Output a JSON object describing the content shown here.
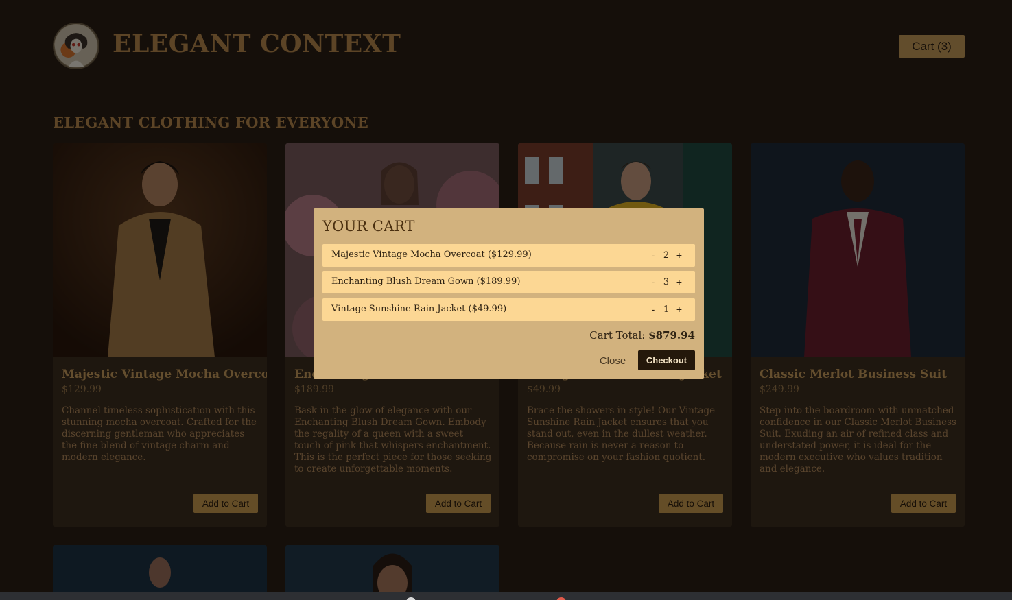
{
  "header": {
    "brand": "ELEGANT CONTEXT",
    "cart_label": "Cart (3)"
  },
  "section_title": "ELEGANT CLOTHING FOR EVERYONE",
  "products": [
    {
      "title": "Majestic Vintage Mocha Overcoat",
      "price": "$129.99",
      "desc": "Channel timeless sophistication with this stunning mocha overcoat. Crafted for the discerning gentleman who appreciates the fine blend of vintage charm and modern elegance.",
      "button": "Add to Cart"
    },
    {
      "title": "Enchanting Blush Dream Gown",
      "price": "$189.99",
      "desc": "Bask in the glow of elegance with our Enchanting Blush Dream Gown. Embody the regality of a queen with a sweet touch of pink that whispers enchantment. This is the perfect piece for those seeking to create unforgettable moments.",
      "button": "Add to Cart"
    },
    {
      "title": "Vintage Sunshine Rain Jacket",
      "price": "$49.99",
      "desc": "Brace the showers in style! Our Vintage Sunshine Rain Jacket ensures that you stand out, even in the dullest weather. Because rain is never a reason to compromise on your fashion quotient.",
      "button": "Add to Cart"
    },
    {
      "title": "Classic Merlot Business Suit",
      "price": "$249.99",
      "desc": "Step into the boardroom with unmatched confidence in our Classic Merlot Business Suit. Exuding an air of refined class and understated power, it is ideal for the modern executive who values tradition and elegance.",
      "button": "Add to Cart"
    }
  ],
  "cart_modal": {
    "title": "YOUR CART",
    "items": [
      {
        "name": "Majestic Vintage Mocha Overcoat ($129.99)",
        "qty": "2",
        "minus": "-",
        "plus": "+"
      },
      {
        "name": "Enchanting Blush Dream Gown ($189.99)",
        "qty": "3",
        "minus": "-",
        "plus": "+"
      },
      {
        "name": "Vintage Sunshine Rain Jacket ($49.99)",
        "qty": "1",
        "minus": "-",
        "plus": "+"
      }
    ],
    "total_label": "Cart Total:",
    "total_value": "$879.94",
    "close_label": "Close",
    "checkout_label": "Checkout"
  },
  "colors": {
    "background": "#2a1f14",
    "accent": "#c59a58",
    "modal": "#d2b27e",
    "cart_row": "#fcd794",
    "checkout": "#24180b"
  }
}
